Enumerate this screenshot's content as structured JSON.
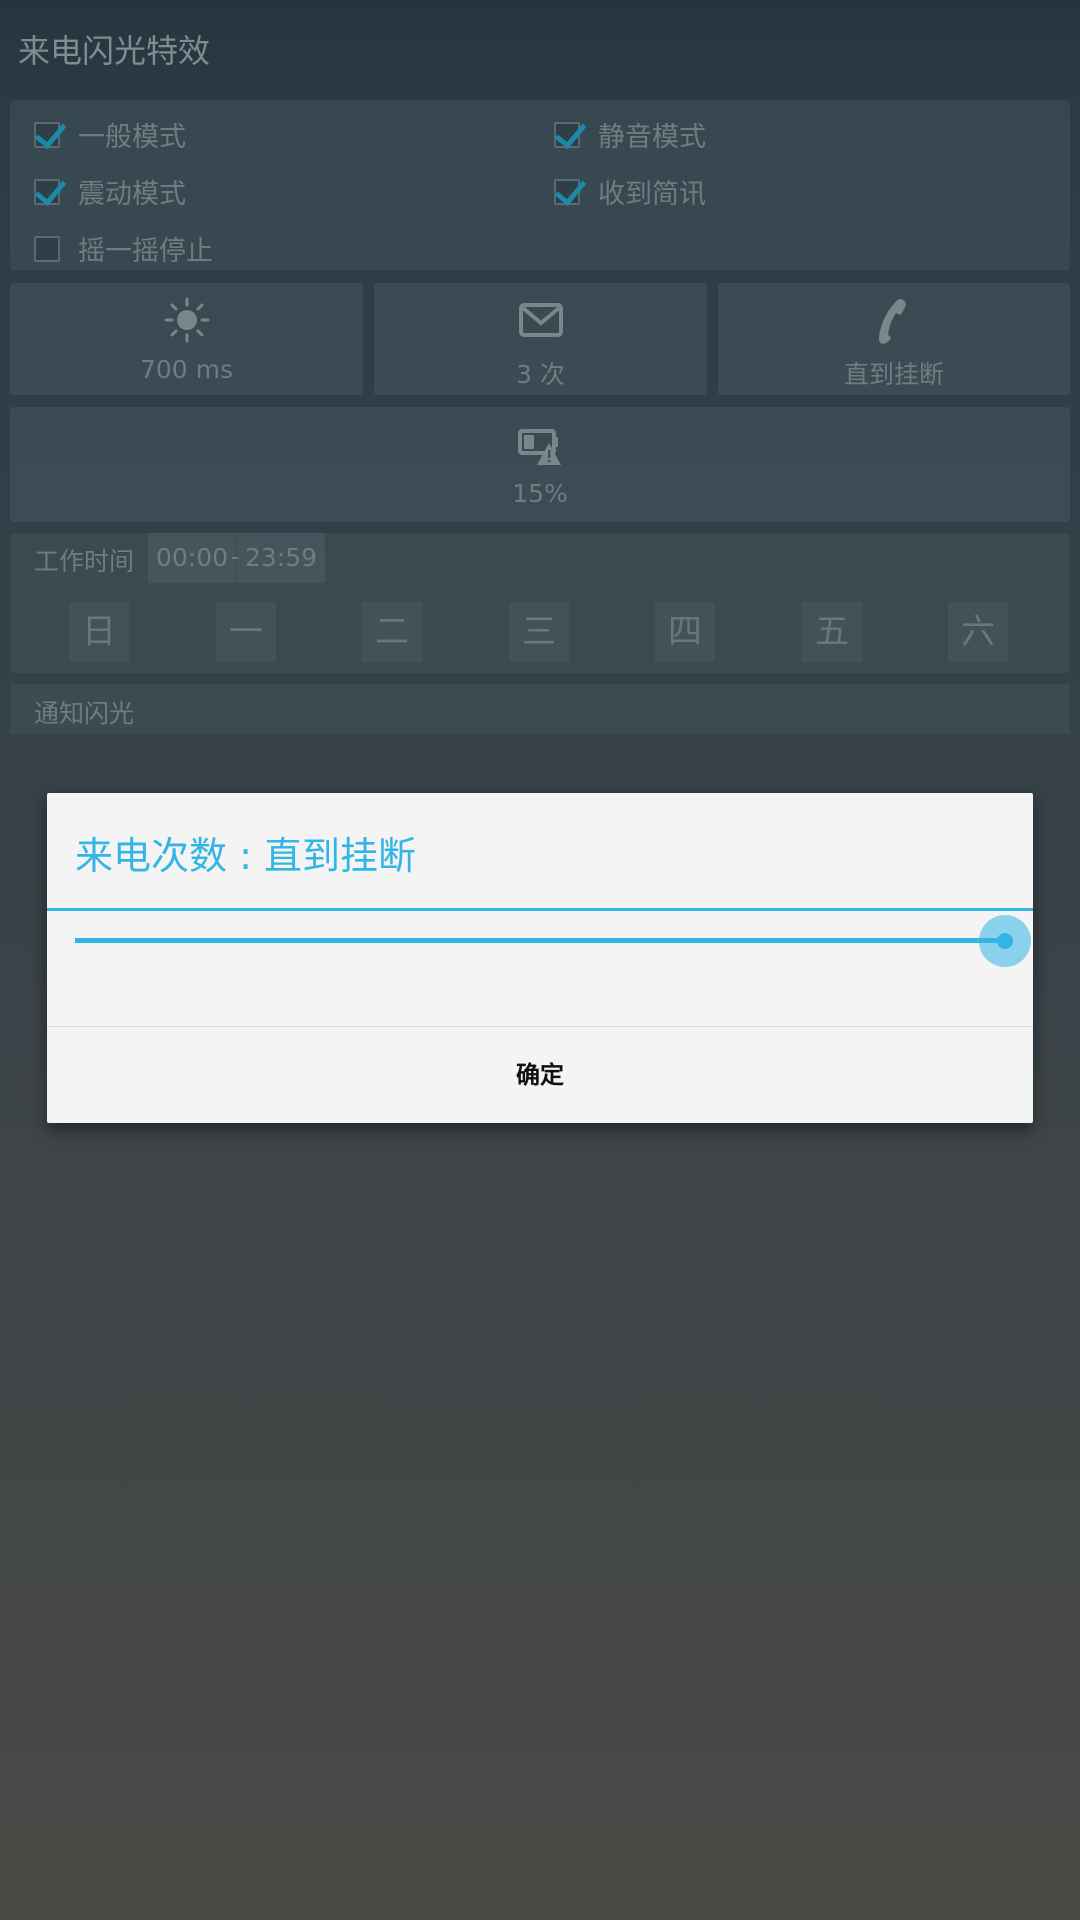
{
  "app": {
    "title": "来电闪光特效"
  },
  "options": [
    {
      "label": "一般模式",
      "checked": true
    },
    {
      "label": "静音模式",
      "checked": true
    },
    {
      "label": "震动模式",
      "checked": true
    },
    {
      "label": "收到简讯",
      "checked": true
    },
    {
      "label": "摇一摇停止",
      "checked": false
    }
  ],
  "tiles": {
    "flash_speed": {
      "icon": "sun-icon",
      "value": "700 ms"
    },
    "message_count": {
      "icon": "mail-icon",
      "value": "3 次"
    },
    "call_count": {
      "icon": "phone-icon",
      "value": "直到挂断"
    },
    "battery": {
      "icon": "battery-warning-icon",
      "value": "15%"
    }
  },
  "work_time": {
    "label": "工作时间",
    "start": "00:00",
    "separator": "-",
    "end": "23:59"
  },
  "days": [
    "日",
    "一",
    "二",
    "三",
    "四",
    "五",
    "六"
  ],
  "notification": {
    "label": "通知闪光"
  },
  "dialog": {
    "title": "来电次数 : 直到挂断",
    "slider_value_fraction": 1.0,
    "ok_label": "确定"
  },
  "colors": {
    "accent": "#33b5e5",
    "check": "#1a8aa8"
  }
}
